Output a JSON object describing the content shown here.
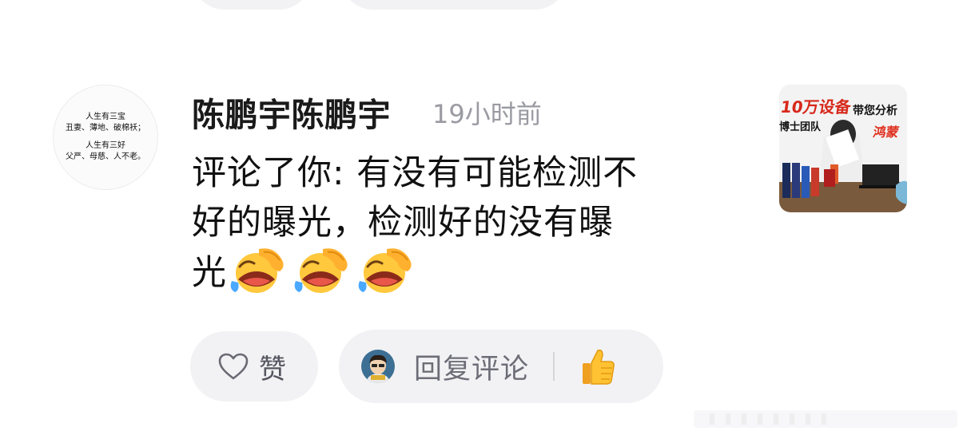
{
  "comment": {
    "author": {
      "name": "陈鹏宇陈鹏宇",
      "avatar_lines": [
        "人生有三宝",
        "丑妻、薄地、破棉袄；",
        "人生有三好",
        "父严、母慈、人不老。"
      ]
    },
    "time": "19小时前",
    "text_line1": "评论了你: 有没有可能检测不",
    "text_line2": "好的曝光，检测好的没有曝",
    "text_line3": "光",
    "emojis": [
      "face-with-tears-of-joy-icon",
      "face-with-tears-of-joy-icon",
      "face-with-tears-of-joy-icon"
    ],
    "thumbnail": {
      "caption1": "10万设备",
      "caption2": "带您分析",
      "caption3": "博士团队",
      "caption4": "鸿蒙"
    }
  },
  "actions": {
    "like_label": "赞",
    "reply_label": "回复评论"
  },
  "colors": {
    "pill_bg": "#f2f2f4",
    "time_text": "#9a9aa2",
    "username_text": "#1a1a1a"
  }
}
